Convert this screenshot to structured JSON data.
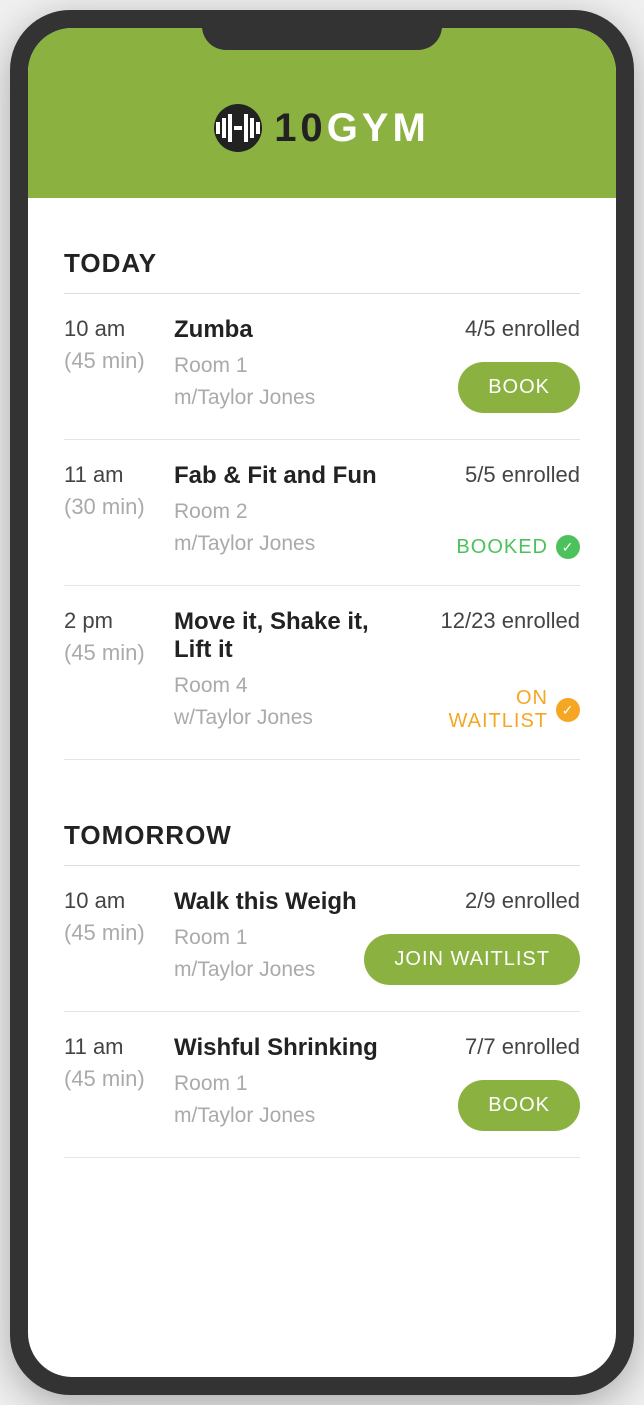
{
  "brand": {
    "io": "10",
    "gym": "GYM"
  },
  "sections": [
    {
      "title": "TODAY",
      "classes": [
        {
          "time": "10 am",
          "duration": "(45 min)",
          "name": "Zumba",
          "room": "Room 1",
          "instructor": "m/Taylor Jones",
          "enrolled": "4/5 enrolled",
          "action_type": "button",
          "action_label": "BOOK"
        },
        {
          "time": "11 am",
          "duration": "(30 min)",
          "name": "Fab & Fit and Fun",
          "room": "Room 2",
          "instructor": "m/Taylor Jones",
          "enrolled": "5/5 enrolled",
          "action_type": "status_booked",
          "action_label": "BOOKED"
        },
        {
          "time": "2 pm",
          "duration": "(45 min)",
          "name": "Move it, Shake it, Lift it",
          "room": "Room 4",
          "instructor": "w/Taylor Jones",
          "enrolled": "12/23 enrolled",
          "action_type": "status_waitlist",
          "action_label": "ON WAITLIST"
        }
      ]
    },
    {
      "title": "TOMORROW",
      "classes": [
        {
          "time": "10 am",
          "duration": "(45 min)",
          "name": "Walk this Weigh",
          "room": "Room 1",
          "instructor": "m/Taylor Jones",
          "enrolled": "2/9 enrolled",
          "action_type": "button",
          "action_label": "JOIN WAITLIST"
        },
        {
          "time": "11 am",
          "duration": "(45 min)",
          "name": "Wishful Shrinking",
          "room": "Room 1",
          "instructor": "m/Taylor Jones",
          "enrolled": "7/7 enrolled",
          "action_type": "button",
          "action_label": "BOOK"
        }
      ]
    }
  ]
}
